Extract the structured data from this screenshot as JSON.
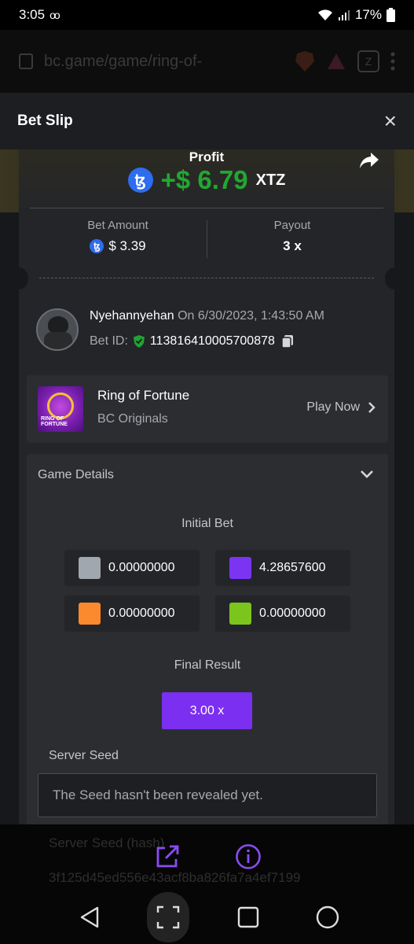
{
  "status_bar": {
    "time": "3:05",
    "voicemail_icon": "oo",
    "battery": "17%"
  },
  "browser": {
    "url": "bc.game/game/ring-of-",
    "tab_count": "Z"
  },
  "bet_slip": {
    "title": "Bet Slip",
    "close_label": "×"
  },
  "profit": {
    "label": "Profit",
    "amount": "+$ 6.79",
    "currency": "XTZ",
    "coin_glyph": "ꜩ"
  },
  "bet_amount": {
    "label": "Bet Amount",
    "value": "$ 3.39"
  },
  "payout": {
    "label": "Payout",
    "value": "3 x"
  },
  "user": {
    "name": "Nyehannyehan",
    "date": "On 6/30/2023, 1:43:50 AM",
    "bet_id_label": "Bet ID:",
    "bet_id": "113816410005700878"
  },
  "game": {
    "title": "Ring of Fortune",
    "provider": "BC Originals",
    "play_label": "Play Now",
    "thumb_text_1": "RING OF",
    "thumb_text_2": "FORTUNE"
  },
  "details": {
    "header": "Game Details",
    "initial_bet_label": "Initial Bet",
    "bets": [
      {
        "color": "#a1a7ae",
        "value": "0.00000000"
      },
      {
        "color": "#7b35f2",
        "value": "4.28657600"
      },
      {
        "color": "#fb8a2e",
        "value": "0.00000000"
      },
      {
        "color": "#7cc51c",
        "value": "0.00000000"
      }
    ],
    "final_result_label": "Final Result",
    "final_result": "3.00 x",
    "server_seed_label": "Server Seed",
    "server_seed_value": "The Seed hasn't been revealed yet.",
    "server_seed_hash_label": "Server Seed (hash)",
    "server_seed_hash": "3f125d45ed556e43acf8ba826fa7a4ef7199"
  },
  "colors": {
    "accent": "#7b2ff0",
    "profit_green": "#21a831",
    "coin_blue": "#2e6cf0"
  }
}
